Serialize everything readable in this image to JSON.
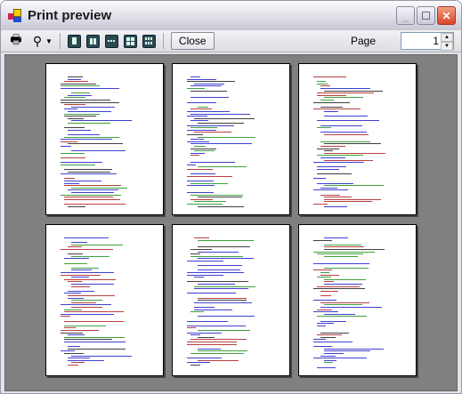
{
  "window": {
    "title": "Print preview",
    "icon": "print-preview-app-icon"
  },
  "toolbar": {
    "print_icon": "printer-icon",
    "zoom_icon": "magnifier-icon",
    "layouts": [
      "one-page",
      "two-pages",
      "three-pages",
      "four-pages",
      "six-pages"
    ],
    "close_label": "Close",
    "page_label": "Page",
    "page_value": "1"
  },
  "preview": {
    "pages_shown": 6,
    "colors": {
      "keyword": "#0000c0",
      "comment": "#008000",
      "string": "#a00000",
      "text": "#000000"
    }
  }
}
